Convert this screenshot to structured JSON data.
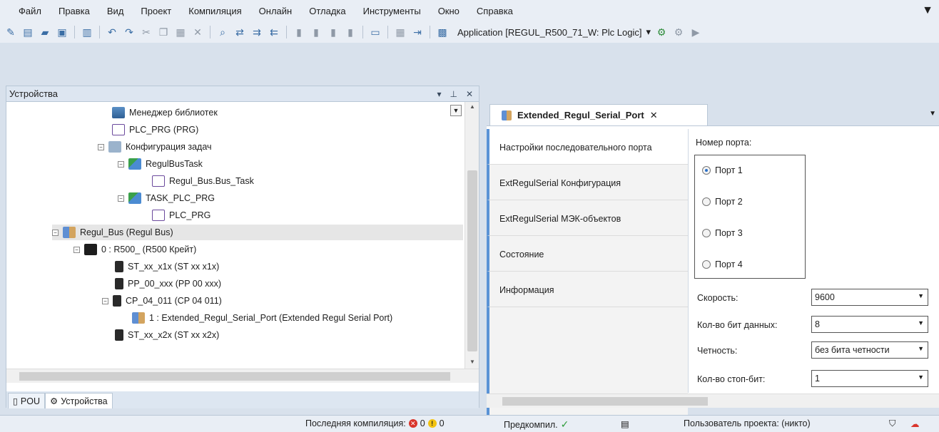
{
  "menu": {
    "items": [
      "Файл",
      "Правка",
      "Вид",
      "Проект",
      "Компиляция",
      "Онлайн",
      "Отладка",
      "Инструменты",
      "Окно",
      "Справка"
    ]
  },
  "toolbar": {
    "application_label": "Application [REGUL_R500_71_W: Plc Logic]"
  },
  "devices": {
    "title": "Устройства",
    "tree": [
      {
        "label": "Менеджер библиотек"
      },
      {
        "label": "PLC_PRG (PRG)"
      },
      {
        "label": "Конфигурация задач"
      },
      {
        "label": "RegulBusTask"
      },
      {
        "label": "Regul_Bus.Bus_Task"
      },
      {
        "label": "TASK_PLC_PRG"
      },
      {
        "label": "PLC_PRG"
      },
      {
        "label": "Regul_Bus (Regul Bus)"
      },
      {
        "label": "0 : R500_ (R500 Крейт)"
      },
      {
        "label": "ST_xx_x1x (ST xx x1x)"
      },
      {
        "label": "PP_00_xxx (PP 00 xxx)"
      },
      {
        "label": "CP_04_011 (CP 04 011)"
      },
      {
        "label": "1 : Extended_Regul_Serial_Port (Extended Regul Serial Port)"
      },
      {
        "label": "ST_xx_x2x (ST xx x2x)"
      }
    ],
    "bottom_tabs": [
      "POU",
      "Устройства"
    ]
  },
  "editor": {
    "tab_title": "Extended_Regul_Serial_Port",
    "subnav": [
      {
        "label": "Настройки последовательного порта"
      },
      {
        "label": "ExtRegulSerial Конфигурация"
      },
      {
        "label": "ExtRegulSerial МЭК-объектов"
      },
      {
        "label": "Состояние"
      },
      {
        "label": "Информация"
      }
    ],
    "settings": {
      "port_label": "Номер порта:",
      "ports": [
        "Порт 1",
        "Порт 2",
        "Порт 3",
        "Порт 4"
      ],
      "selected_port": "Порт 1",
      "speed_label": "Скорость:",
      "speed_value": "9600",
      "databits_label": "Кол-во бит данных:",
      "databits_value": "8",
      "parity_label": "Четность:",
      "parity_value": "без бита четности",
      "stopbits_label": "Кол-во стоп-бит:",
      "stopbits_value": "1"
    }
  },
  "status": {
    "last_compile_label": "Последняя компиляция:",
    "errors": "0",
    "warnings": "0",
    "precompile_label": "Предкомпил.",
    "project_user": "Пользователь проекта: (никто)"
  },
  "colors": {
    "accent": "#5a93d6",
    "background": "#d8e1ec"
  }
}
